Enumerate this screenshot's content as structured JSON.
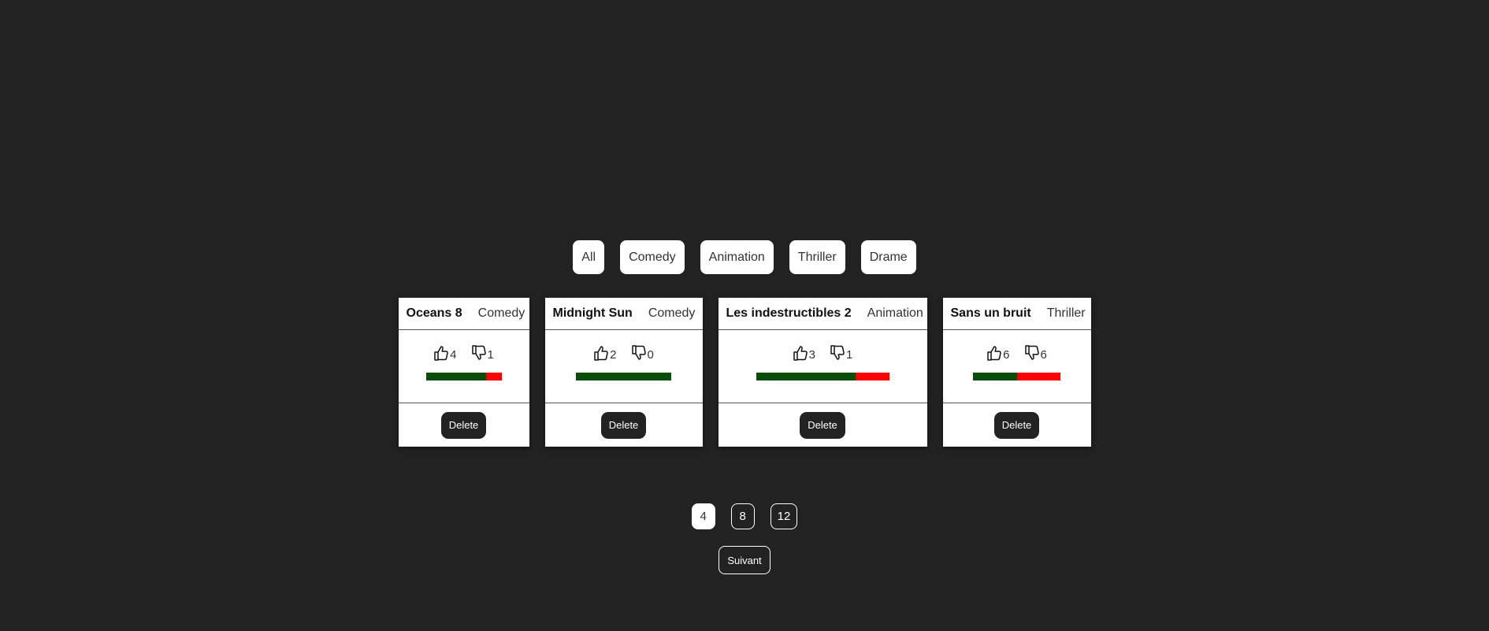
{
  "filters": {
    "items": [
      {
        "label": "All"
      },
      {
        "label": "Comedy"
      },
      {
        "label": "Animation"
      },
      {
        "label": "Thriller"
      },
      {
        "label": "Drame"
      }
    ]
  },
  "movies": [
    {
      "title": "Oceans 8",
      "category": "Comedy",
      "likes": "4",
      "dislikes": "1",
      "like_ratio": 0.8
    },
    {
      "title": "Midnight Sun",
      "category": "Comedy",
      "likes": "2",
      "dislikes": "0",
      "like_ratio": 1.0
    },
    {
      "title": "Les indestructibles 2",
      "category": "Animation",
      "likes": "3",
      "dislikes": "1",
      "like_ratio": 0.75
    },
    {
      "title": "Sans un bruit",
      "category": "Thriller",
      "likes": "6",
      "dislikes": "6",
      "like_ratio": 0.5
    }
  ],
  "card": {
    "delete_label": "Delete"
  },
  "pagination": {
    "page_sizes": [
      {
        "label": "4",
        "active": true
      },
      {
        "label": "8",
        "active": false
      },
      {
        "label": "12",
        "active": false
      }
    ],
    "next_label": "Suivant"
  },
  "colors": {
    "background": "#222222",
    "like": "#0a4d0a",
    "dislike": "#ff0000"
  },
  "icons": {
    "like": "thumbs-up-icon",
    "dislike": "thumbs-down-icon"
  }
}
